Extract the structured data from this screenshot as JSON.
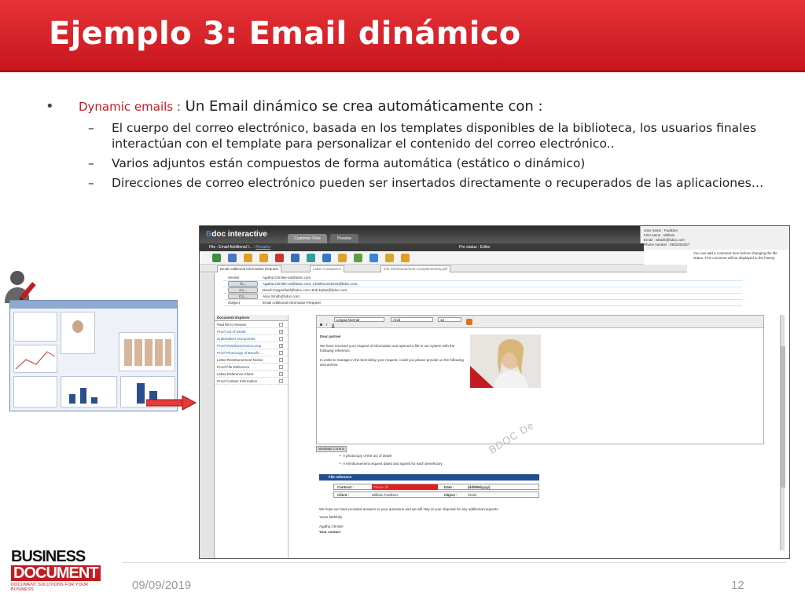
{
  "slide": {
    "title": "Ejemplo 3: Email dinámico",
    "bullet_main": {
      "accent": "Dynamic emails :",
      "text": " Un Email dinámico se crea automáticamente con :"
    },
    "sub_bullets": [
      "El cuerpo del correo electrónico, basada en los templates disponibles de la biblioteca, los usuarios finales interactúan con el template para personalizar el contenido del correo electrónico..",
      "Varios adjuntos están compuestos de forma automática (estático o dinámico)",
      "Direcciones de correo electrónico pueden ser insertados directamente o recuperados de las aplicaciones…"
    ],
    "footer_date": "09/09/2019",
    "page_number": "12",
    "logo_line1": "BUSINESS",
    "logo_line2": "DOCUMENT",
    "logo_tagline": "DOCUMENT SOLUTIONS FOR YOUR BUSINESS",
    "colors": {
      "accent": "#c41a22",
      "title_bar": "#d7232a"
    }
  },
  "app": {
    "brand_letter": "B",
    "brand_rest": "doc interactive",
    "tab_active": "Customer Files",
    "tab_inactive": "Preview",
    "user_lines": [
      "User name : Faulkner",
      "First name : William",
      "Email : wfaulk@bdoc.com",
      "Phone number : 0602303257"
    ],
    "file_label": "File :",
    "file_name": "Email Additional I...",
    "file_link": "Rename",
    "process_status": "Pre status : Editor",
    "note": "You can add a comment here before changing the file status. This comment will be displayed in the history",
    "doc_tabs": [
      "Email Additional Information Request",
      "Letter Acceptance",
      "Info Reimbursement Complementary.pdf"
    ],
    "addresses": [
      {
        "label": "Sender",
        "value": "Agatha.Christie-sa@bdoc.com"
      },
      {
        "label": "To...",
        "value": "Agatha.Christie-sa@bdoc.com; Charles.Dickens@bdoc.com;"
      },
      {
        "label": "Cc...",
        "value": "David.Copperfield@bdoc.com; Bob.Dylan@bdoc.com;"
      },
      {
        "label": "Cci...",
        "value": "Alice.Smith@bdoc.com;"
      },
      {
        "label": "Subject",
        "value": "Email Additional Information Request"
      }
    ],
    "explorer_title": "Document Explorer",
    "explorer_items": [
      {
        "label": "Paid file to Review",
        "blue": false,
        "checked": false
      },
      {
        "label": "Proof out of Death",
        "blue": true,
        "checked": true
      },
      {
        "label": "Undertakers Documents",
        "blue": true,
        "checked": false
      },
      {
        "label": "Proof Reimbursement Lump",
        "blue": true,
        "checked": true
      },
      {
        "label": "Proof Photocopy of Benefic...",
        "blue": true,
        "checked": false
      },
      {
        "label": "Letter Reimbursement Notice",
        "blue": false,
        "checked": false
      },
      {
        "label": "Proof File Reference",
        "blue": false,
        "checked": false
      },
      {
        "label": "Letter Reference Client",
        "blue": false,
        "checked": false
      },
      {
        "label": "Proof Contact Information",
        "blue": false,
        "checked": false
      }
    ],
    "editor_font": "Lingua Normal",
    "editor_family": "Arial",
    "editor_size": "12",
    "email_greeting": "Dear partner",
    "email_body1": "We have received your request of information and opened a file in our system with the following reference.",
    "email_body2": "In order to manage in the best delay your request, could you please provide us the following documents.",
    "editor_mode": "WebMail Control",
    "list_items": [
      "A photocopy of the act of death",
      "A reimbursement request dated and signed for each beneficiary"
    ],
    "file_reference": "File reference",
    "form": {
      "contract_label": "Contract :",
      "contract_value": "Please fill",
      "date_label": "Date :",
      "date_value": "(dd/MM/yyyy)",
      "client_label": "Client :",
      "client_value": "William Faulkner",
      "object_label": "Object :",
      "object_value": "Claim"
    },
    "closing_text": "We hope we have provided answers to your questions and we will stay at your disposal for any additional requests",
    "regards": "Yours faithfully",
    "signature": "Agatha Christie",
    "your_contact": "Your contact",
    "watermark": "BDOC De"
  }
}
